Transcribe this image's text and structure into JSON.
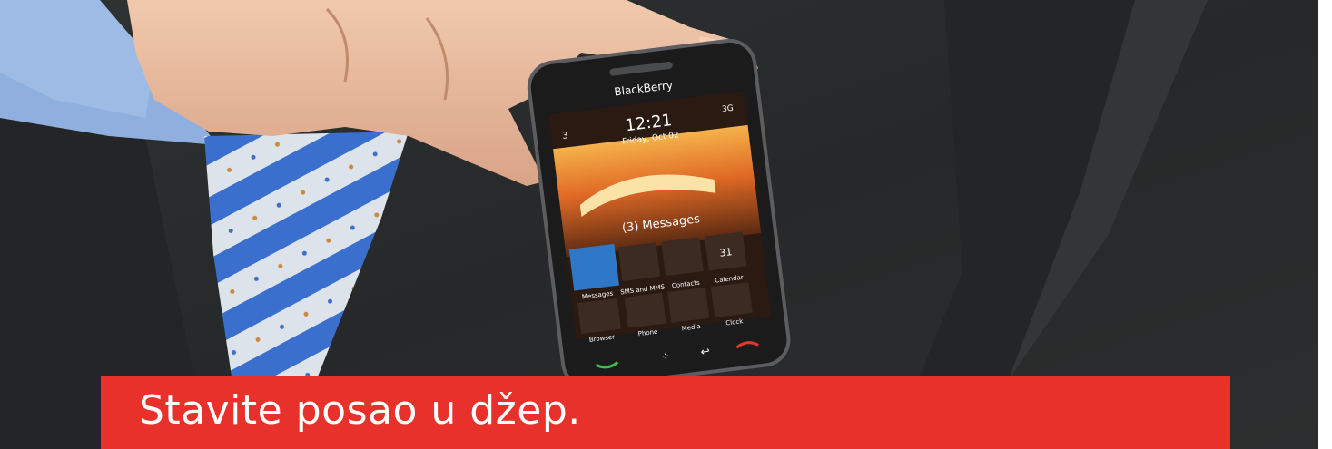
{
  "slogan": "Stavite posao u džep.",
  "phone": {
    "brand": "BlackBerry",
    "status": {
      "time": "12:21",
      "date": "Friday, Oct 02",
      "network": "3G",
      "notification_count": "3"
    },
    "messages_banner": "(3) Messages",
    "apps": [
      {
        "label": "Messages"
      },
      {
        "label": "SMS and MMS"
      },
      {
        "label": "Contacts"
      },
      {
        "label": "Calendar",
        "badge": "31"
      },
      {
        "label": "Browser"
      },
      {
        "label": "Phone"
      },
      {
        "label": "Media"
      },
      {
        "label": "Clock"
      }
    ]
  },
  "colors": {
    "bar": "#e8312a",
    "suit": "#2a2c2d",
    "shirt": "#8fb0df",
    "tie_blue": "#3a6fce",
    "skin": "#e4b59a"
  }
}
